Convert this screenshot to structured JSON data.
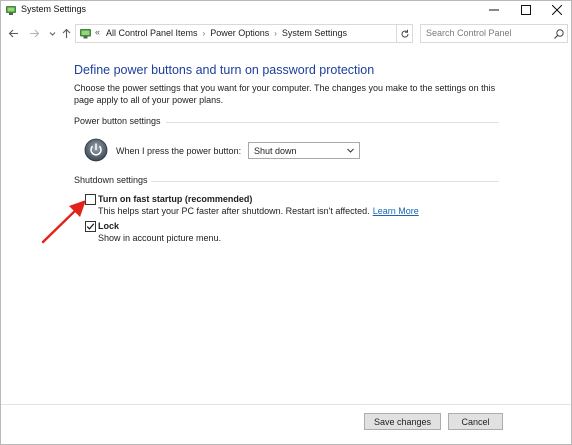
{
  "window": {
    "title": "System Settings",
    "minimize_glyph": "—",
    "maximize_glyph": "☐",
    "close_glyph": "✕"
  },
  "nav": {
    "back_icon": "arrow-left-icon",
    "forward_icon": "arrow-right-icon",
    "recent_icon": "chevron-down-icon",
    "up_icon": "arrow-up-icon"
  },
  "address": {
    "overflow_glyph": "«",
    "breadcrumbs": [
      "All Control Panel Items",
      "Power Options",
      "System Settings"
    ],
    "separator": "›"
  },
  "search": {
    "placeholder": "Search Control Panel"
  },
  "main": {
    "title": "Define power buttons and turn on password protection",
    "intro": "Choose the power settings that you want for your computer. The changes you make to the settings on this page apply to all of your power plans.",
    "power_group": {
      "label": "Power button settings",
      "row_label": "When I press the power button:",
      "selected": "Shut down"
    },
    "shutdown_group": {
      "label": "Shutdown settings",
      "options": [
        {
          "title": "Turn on fast startup (recommended)",
          "description": "This helps start your PC faster after shutdown. Restart isn't affected.",
          "link": "Learn More",
          "checked": false
        },
        {
          "title": "Lock",
          "description": "Show in account picture menu.",
          "checked": true
        }
      ]
    }
  },
  "footer": {
    "save_label": "Save changes",
    "cancel_label": "Cancel"
  },
  "colors": {
    "title_blue": "#1e3f9b",
    "link_blue": "#1a66b5",
    "annotation_red": "#e2231a"
  }
}
